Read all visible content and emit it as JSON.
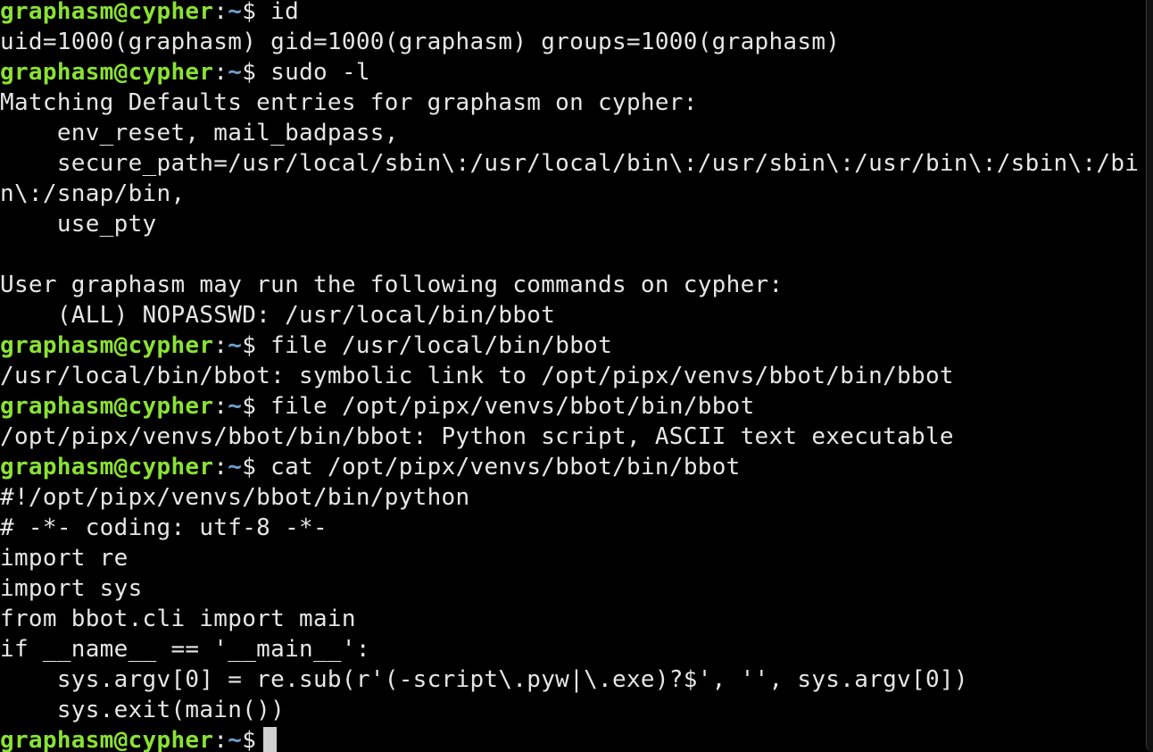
{
  "colors": {
    "background": "#000000",
    "text": "#e6e6e6",
    "prompt_user": "#8ae234",
    "prompt_path": "#729fcf",
    "cursor": "#d0d0d0"
  },
  "prompt": {
    "user_host": "graphasm@cypher",
    "colon": ":",
    "path": "~",
    "symbol": "$"
  },
  "lines": [
    {
      "type": "prompt",
      "command": " id"
    },
    {
      "type": "output",
      "text": "uid=1000(graphasm) gid=1000(graphasm) groups=1000(graphasm)"
    },
    {
      "type": "prompt",
      "command": " sudo -l"
    },
    {
      "type": "output",
      "text": "Matching Defaults entries for graphasm on cypher:"
    },
    {
      "type": "output",
      "text": "    env_reset, mail_badpass,"
    },
    {
      "type": "output",
      "text": "    secure_path=/usr/local/sbin\\:/usr/local/bin\\:/usr/sbin\\:/usr/bin\\:/sbin\\:/bi"
    },
    {
      "type": "output",
      "text": "n\\:/snap/bin,"
    },
    {
      "type": "output",
      "text": "    use_pty"
    },
    {
      "type": "output",
      "text": ""
    },
    {
      "type": "output",
      "text": "User graphasm may run the following commands on cypher:"
    },
    {
      "type": "output",
      "text": "    (ALL) NOPASSWD: /usr/local/bin/bbot"
    },
    {
      "type": "prompt",
      "command": " file /usr/local/bin/bbot"
    },
    {
      "type": "output",
      "text": "/usr/local/bin/bbot: symbolic link to /opt/pipx/venvs/bbot/bin/bbot"
    },
    {
      "type": "prompt",
      "command": " file /opt/pipx/venvs/bbot/bin/bbot"
    },
    {
      "type": "output",
      "text": "/opt/pipx/venvs/bbot/bin/bbot: Python script, ASCII text executable"
    },
    {
      "type": "prompt",
      "command": " cat /opt/pipx/venvs/bbot/bin/bbot"
    },
    {
      "type": "output",
      "text": "#!/opt/pipx/venvs/bbot/bin/python"
    },
    {
      "type": "output",
      "text": "# -*- coding: utf-8 -*-"
    },
    {
      "type": "output",
      "text": "import re"
    },
    {
      "type": "output",
      "text": "import sys"
    },
    {
      "type": "output",
      "text": "from bbot.cli import main"
    },
    {
      "type": "output",
      "text": "if __name__ == '__main__':"
    },
    {
      "type": "output",
      "text": "    sys.argv[0] = re.sub(r'(-script\\.pyw|\\.exe)?$', '', sys.argv[0])"
    },
    {
      "type": "output",
      "text": "    sys.exit(main())"
    },
    {
      "type": "prompt",
      "command": "",
      "cursor": true
    }
  ]
}
